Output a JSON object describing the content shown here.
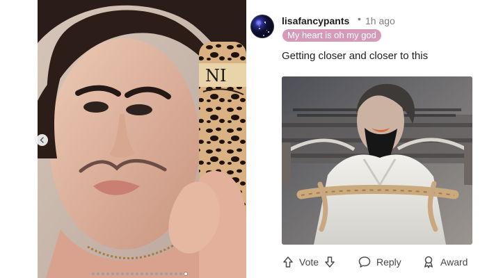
{
  "post": {
    "username": "lisafancypants",
    "separator": "•",
    "time": "1h ago",
    "flair": "My heart is oh my god",
    "text": "Getting closer and closer to this"
  },
  "actions": {
    "vote_label": "Vote",
    "reply_label": "Reply",
    "award_label": "Award"
  },
  "icons": {
    "avatar": "starry-night-avatar",
    "upvote": "arrow-up-icon",
    "downvote": "arrow-down-icon",
    "reply": "speech-bubble-icon",
    "award": "ribbon-award-icon",
    "carousel": "chevron-left-icon"
  },
  "carousel": {
    "dot_count": 20,
    "active_index": 19
  },
  "colors": {
    "flair": "#d49ab8",
    "text": "#1c1c1c",
    "muted": "#7c7c7c"
  }
}
